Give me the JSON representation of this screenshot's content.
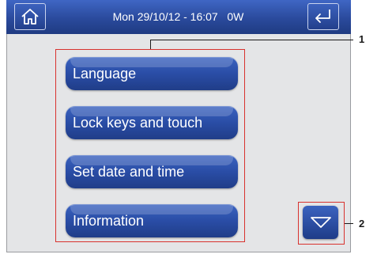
{
  "status_bar": {
    "datetime": "Mon 29/10/12 - 16:07",
    "power": "0W"
  },
  "icons": {
    "home": "home-icon",
    "back": "return-arrow-icon",
    "scroll": "chevron-down-icon"
  },
  "menu": {
    "items": [
      {
        "label": "Language"
      },
      {
        "label": "Lock keys and touch"
      },
      {
        "label": "Set date and time"
      },
      {
        "label": "Information"
      }
    ]
  },
  "callouts": [
    "1",
    "2"
  ],
  "colors": {
    "bar_blue": "#2a4a9c",
    "button_blue": "#2a4da6",
    "highlight_red": "#d8322e",
    "screen_bg": "#e4e5e7"
  }
}
